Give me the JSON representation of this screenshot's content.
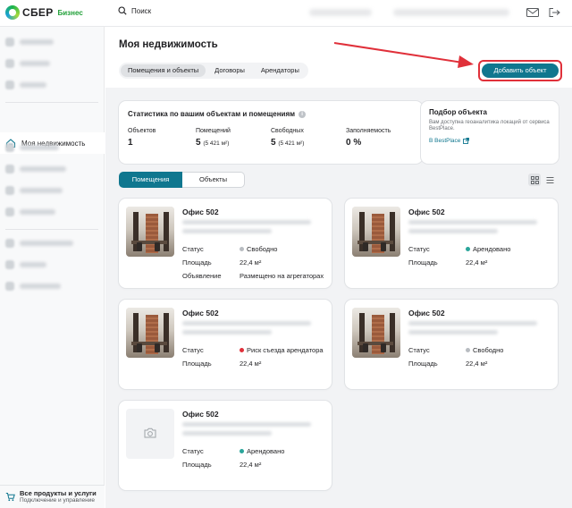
{
  "brand": {
    "name": "СБЕР",
    "sub": "Бизнес"
  },
  "search": {
    "placeholder": "Поиск"
  },
  "sidebar": {
    "active_label": "Моя недвижимость",
    "bottom_title": "Все продукты и услуги",
    "bottom_sub": "Подключение и управление"
  },
  "page": {
    "title": "Моя недвижимость",
    "tabs": [
      "Помещения и объекты",
      "Договоры",
      "Арендаторы"
    ],
    "add_button": "Добавить объект"
  },
  "stats": {
    "title": "Статистика по вашим объектам и помещениям",
    "cols": [
      {
        "label": "Объектов",
        "value": "1",
        "extra": ""
      },
      {
        "label": "Помещений",
        "value": "5",
        "extra": "(5 421 м²)"
      },
      {
        "label": "Свободных",
        "value": "5",
        "extra": "(5 421 м²)"
      },
      {
        "label": "Заполняемость",
        "value": "0 %",
        "extra": ""
      }
    ]
  },
  "pick": {
    "title": "Подбор объекта",
    "desc": "Вам доступна геоаналитика локаций от сервиса BestPlace.",
    "link": "В BestPlace"
  },
  "segment": {
    "items": [
      "Помещения",
      "Объекты"
    ]
  },
  "colors": {
    "accent": "#10778f",
    "free": "#b8bcc1",
    "rented": "#2aa59a",
    "risk": "#e0303a",
    "highlight": "#e0303a"
  },
  "cards": [
    {
      "title": "Офис 502",
      "status_label": "Статус",
      "status": "Свободно",
      "status_color": "#b8bcc1",
      "area_label": "Площадь",
      "area": "22,4 м²",
      "ad_label": "Объявление",
      "ad": "Размещено на агрегаторах"
    },
    {
      "title": "Офис 502",
      "status_label": "Статус",
      "status": "Арендовано",
      "status_color": "#2aa59a",
      "area_label": "Площадь",
      "area": "22,4 м²"
    },
    {
      "title": "Офис 502",
      "status_label": "Статус",
      "status": "Риск съезда арендатора",
      "status_color": "#e0303a",
      "area_label": "Площадь",
      "area": "22,4 м²"
    },
    {
      "title": "Офис 502",
      "status_label": "Статус",
      "status": "Свободно",
      "status_color": "#b8bcc1",
      "area_label": "Площадь",
      "area": "22,4 м²"
    },
    {
      "title": "Офис 502",
      "status_label": "Статус",
      "status": "Арендовано",
      "status_color": "#2aa59a",
      "area_label": "Площадь",
      "area": "22,4 м²"
    }
  ]
}
